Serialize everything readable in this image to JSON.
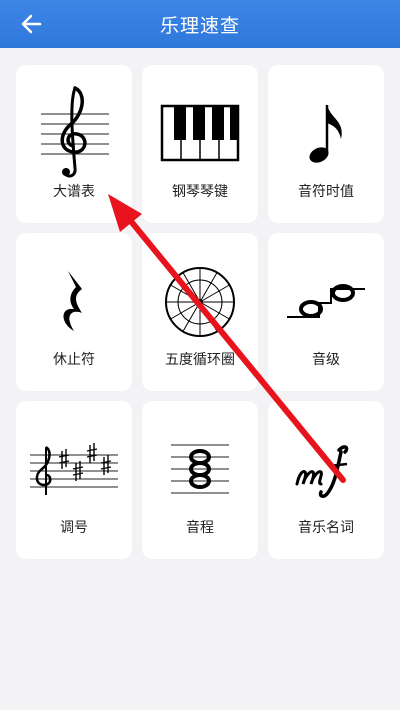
{
  "header": {
    "title": "乐理速查",
    "back_icon": "arrow-left-icon",
    "background": "#3a82e3"
  },
  "cards": [
    {
      "label": "大谱表",
      "icon": "treble-clef-staff-icon"
    },
    {
      "label": "钢琴琴键",
      "icon": "piano-keys-icon"
    },
    {
      "label": "音符时值",
      "icon": "eighth-note-icon"
    },
    {
      "label": "休止符",
      "icon": "quarter-rest-icon"
    },
    {
      "label": "五度循环圈",
      "icon": "circle-of-fifths-icon"
    },
    {
      "label": "音级",
      "icon": "note-steps-icon"
    },
    {
      "label": "调号",
      "icon": "key-signature-icon"
    },
    {
      "label": "音程",
      "icon": "interval-chord-icon"
    },
    {
      "label": "音乐名词",
      "icon": "mf-dynamic-icon"
    }
  ],
  "annotation": {
    "arrow_color": "#e8131d"
  }
}
